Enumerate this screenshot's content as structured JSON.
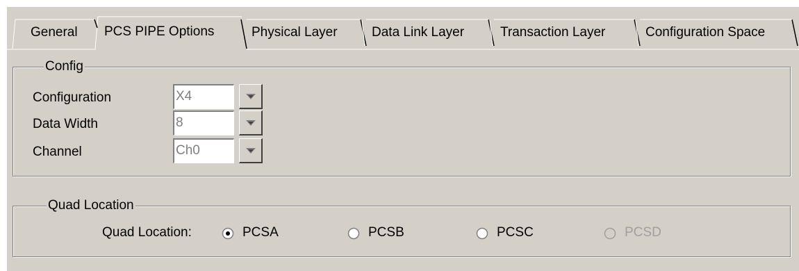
{
  "tabs": [
    {
      "label": "General",
      "active": false
    },
    {
      "label": "PCS PIPE Options",
      "active": true
    },
    {
      "label": "Physical Layer",
      "active": false
    },
    {
      "label": "Data Link Layer",
      "active": false
    },
    {
      "label": "Transaction Layer",
      "active": false
    },
    {
      "label": "Configuration Space",
      "active": false
    }
  ],
  "config": {
    "title": "Config",
    "rows": [
      {
        "label": "Configuration",
        "value": "X4"
      },
      {
        "label": "Data Width",
        "value": "8"
      },
      {
        "label": "Channel",
        "value": "Ch0"
      }
    ]
  },
  "quad": {
    "title": "Quad Location",
    "label": "Quad Location:",
    "options": [
      {
        "label": "PCSA",
        "selected": true,
        "enabled": true
      },
      {
        "label": "PCSB",
        "selected": false,
        "enabled": true
      },
      {
        "label": "PCSC",
        "selected": false,
        "enabled": true
      },
      {
        "label": "PCSD",
        "selected": false,
        "enabled": false
      }
    ]
  },
  "colors": {
    "face": "#d4d0c8",
    "shadow": "#808080",
    "disabled_text": "#a0a0a0"
  },
  "icons": {
    "dropdown": "chevron-down-icon",
    "radio": "radio-icon"
  }
}
